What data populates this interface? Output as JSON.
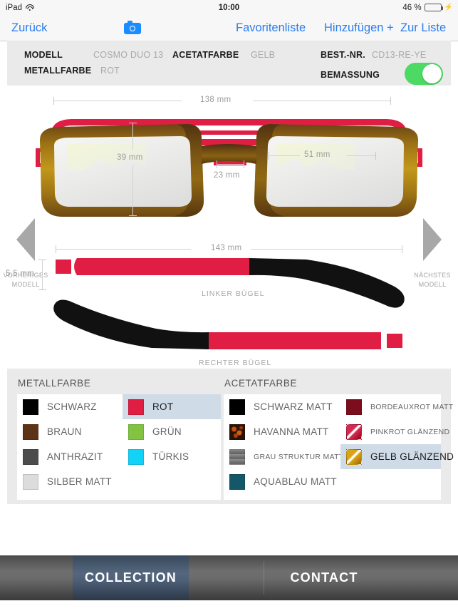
{
  "statusbar": {
    "device": "iPad",
    "wifi_icon": "wifi-icon",
    "time": "10:00",
    "battery_percent": "46 %",
    "battery_level": 46,
    "charging_icon": "bolt-icon"
  },
  "navbar": {
    "back": "Zurück",
    "camera_icon": "camera-icon",
    "favorites": "Favoritenliste",
    "add": "Hinzufügen +",
    "to_list": "Zur Liste",
    "accent_color": "#2a7df0"
  },
  "infobar": {
    "model_label": "MODELL",
    "model_value": "COSMO DUO 13",
    "acetate_label": "ACETATFARBE",
    "acetate_value": "GELB",
    "metal_label": "METALLFARBE",
    "metal_value": "ROT",
    "order_label": "BEST.-NR.",
    "order_value": "CD13-RE-YE",
    "dimension_label": "BEMASSUNG",
    "dimension_toggle_on": true,
    "toggle_on_color": "#4cd964"
  },
  "stage": {
    "prev_arrow": {
      "icon": "chevron-left-icon",
      "line1": "VORHERIGES",
      "line2": "MODELL"
    },
    "next_arrow": {
      "icon": "chevron-right-icon",
      "line1": "NÄCHSTES",
      "line2": "MODELL"
    },
    "front": {
      "width": "138 mm",
      "lens_height": "39 mm",
      "bridge": "23 mm",
      "lens_width": "51 mm"
    },
    "temple": {
      "length": "143 mm",
      "thickness": "5.5 mm",
      "left_caption": "LINKER BÜGEL",
      "right_caption": "RECHTER BÜGEL"
    },
    "colors": {
      "metal_red": "#e01e43",
      "acetate_gold_light": "#b8860b",
      "acetate_gold_dark": "#5c3a12",
      "temple_black": "#111111"
    }
  },
  "picker": {
    "metal": {
      "title": "METALLFARBE",
      "columns": [
        [
          {
            "label": "SCHWARZ",
            "color": "#000000",
            "selected": false
          },
          {
            "label": "BRAUN",
            "color": "#5b3317",
            "selected": false
          },
          {
            "label": "ANTHRAZIT",
            "color": "#4c4c4c",
            "selected": false
          },
          {
            "label": "SILBER MATT",
            "color": "#dcdcdc",
            "selected": false
          }
        ],
        [
          {
            "label": "ROT",
            "color": "#e01e43",
            "selected": true
          },
          {
            "label": "GRÜN",
            "color": "#82c341",
            "selected": false
          },
          {
            "label": "TÜRKIS",
            "color": "#12d2f7",
            "selected": false
          }
        ]
      ]
    },
    "acetate": {
      "title": "ACETATFARBE",
      "columns": [
        [
          {
            "label": "SCHWARZ MATT",
            "color": "#000000",
            "selected": false,
            "small": false
          },
          {
            "label": "HAVANNA MATT",
            "color": "#2a1206",
            "selected": false,
            "small": false,
            "texture": "havanna"
          },
          {
            "label": "GRAU STRUKTUR MATT",
            "color": "#6e6e6e",
            "selected": false,
            "small": true,
            "texture": "grau"
          },
          {
            "label": "AQUABLAU MATT",
            "color": "#15576a",
            "selected": false,
            "small": false
          }
        ],
        [
          {
            "label": "BORDEAUXROT MATT",
            "color": "#7c0d1c",
            "selected": false,
            "small": true
          },
          {
            "label": "PINKROT GLÄNZEND",
            "color": "#d42a52",
            "selected": false,
            "small": true,
            "texture": "gloss"
          },
          {
            "label": "GELB GLÄNZEND",
            "color": "#d9a414",
            "selected": true,
            "small": false,
            "texture": "gloss"
          }
        ]
      ]
    },
    "selected_row_color": "#cfdce8"
  },
  "tabbar": {
    "tabs": [
      {
        "label": "COLLECTION",
        "active": true
      },
      {
        "label": "CONTACT",
        "active": false
      }
    ],
    "active_color": "#4e6078"
  }
}
